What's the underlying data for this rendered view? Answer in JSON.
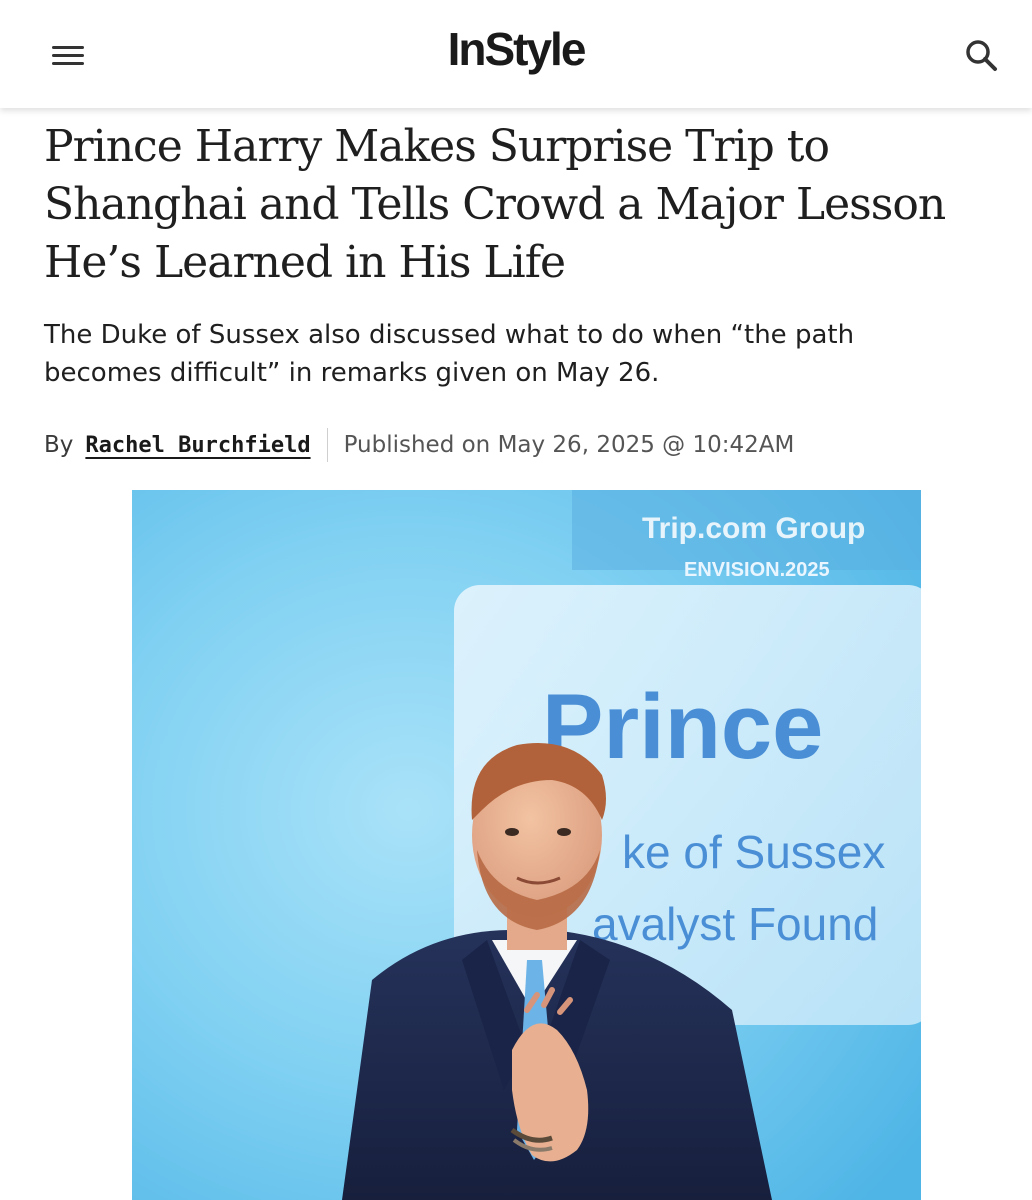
{
  "header": {
    "logo": "InStyle",
    "menu_icon": "hamburger-menu-icon",
    "search_icon": "search-icon"
  },
  "article": {
    "headline": "Prince Harry Makes Surprise Trip to Shanghai and Tells Crowd a Major Lesson He’s Learned in His Life",
    "dek": "The Duke of Sussex also discussed what to do when “the path becomes difficult” in remarks given on May 26.",
    "by_label": "By",
    "author": "Rachel Burchfield",
    "published": "Published on May 26, 2025 @ 10:42AM"
  },
  "hero": {
    "sign_brand": "Trip.com Group",
    "sign_event": "ENVISION.2025",
    "sign_name": "Prince",
    "sign_line2": "ke of Sussex",
    "sign_line3": "avalyst Found"
  },
  "colors": {
    "text": "#1f1f1f",
    "muted": "#555555",
    "hero_bg": "#6cc7ee",
    "sign_text": "#4a8fd6"
  }
}
